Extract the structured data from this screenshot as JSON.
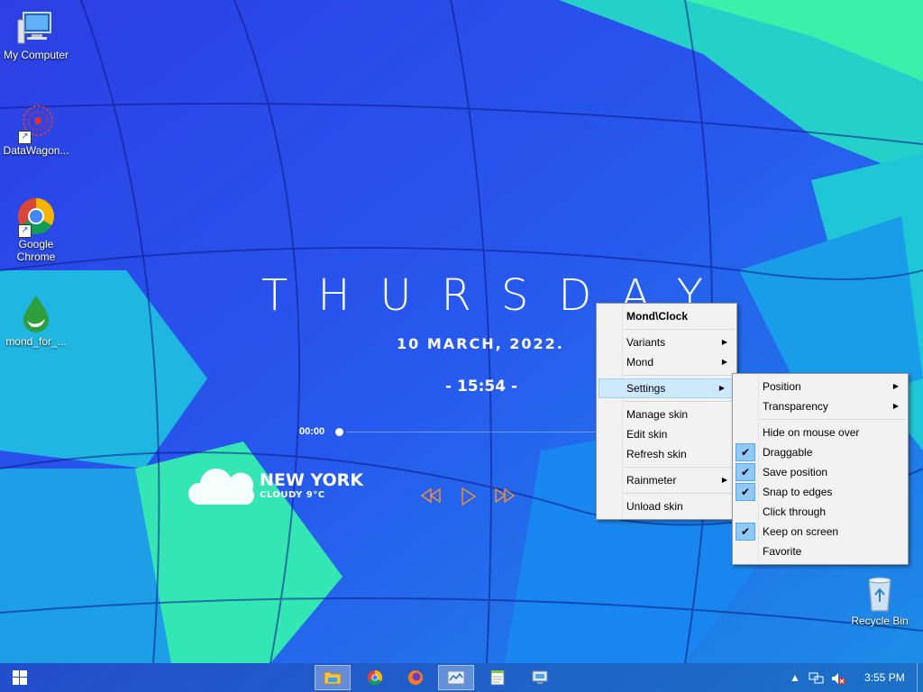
{
  "desktop": {
    "icons": [
      {
        "label": "My Computer",
        "icon": "computer-icon"
      },
      {
        "label": "DataWagon...",
        "icon": "datawagon-icon"
      },
      {
        "label": "Google Chrome",
        "icon": "chrome-icon"
      },
      {
        "label": "mond_for_...",
        "icon": "mond-droplet-icon"
      },
      {
        "label": "Recycle Bin",
        "icon": "recycle-bin-icon"
      }
    ]
  },
  "skin": {
    "day": "THURSDAY",
    "date": "10 MARCH, 2022.",
    "time": "- 15:54 -",
    "player_time": "00:00",
    "city": "NEW YORK",
    "condition": "CLOUDY 9°C"
  },
  "context_menu": {
    "title": "Mond\\Clock",
    "items": {
      "variants": "Variants",
      "mond": "Mond",
      "settings": "Settings",
      "manage_skin": "Manage skin",
      "edit_skin": "Edit skin",
      "refresh_skin": "Refresh skin",
      "rainmeter": "Rainmeter",
      "unload_skin": "Unload skin"
    }
  },
  "settings_menu": {
    "items": [
      {
        "label": "Position",
        "submenu": true,
        "checked": false
      },
      {
        "label": "Transparency",
        "submenu": true,
        "checked": false
      },
      {
        "label": "Hide on mouse over",
        "submenu": false,
        "checked": false
      },
      {
        "label": "Draggable",
        "submenu": false,
        "checked": true
      },
      {
        "label": "Save position",
        "submenu": false,
        "checked": true
      },
      {
        "label": "Snap to edges",
        "submenu": false,
        "checked": true
      },
      {
        "label": "Click through",
        "submenu": false,
        "checked": false
      },
      {
        "label": "Keep on screen",
        "submenu": false,
        "checked": true
      },
      {
        "label": "Favorite",
        "submenu": false,
        "checked": false
      }
    ]
  },
  "taskbar": {
    "clock": "3:55 PM",
    "apps": [
      "file-explorer-icon",
      "chrome-icon",
      "firefox-icon",
      "rainmeter-icon",
      "notepad-icon",
      "network-monitor-icon"
    ]
  },
  "colors": {
    "menu_highlight": "#cde8ff",
    "check_bg": "#90c8f6",
    "media_orange": "#f08a3c"
  }
}
